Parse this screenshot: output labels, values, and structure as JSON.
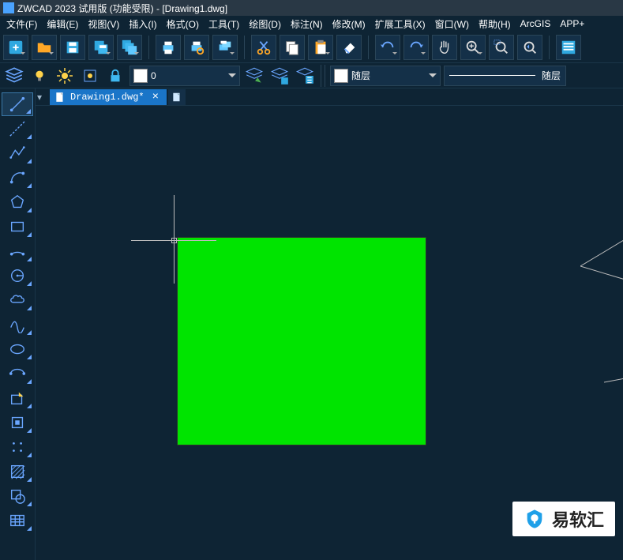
{
  "title": "ZWCAD 2023 试用版 (功能受限) - [Drawing1.dwg]",
  "menu": {
    "file": "文件(F)",
    "edit": "编辑(E)",
    "view": "视图(V)",
    "insert": "插入(I)",
    "format": "格式(O)",
    "tools": "工具(T)",
    "draw": "绘图(D)",
    "annotate": "标注(N)",
    "modify": "修改(M)",
    "ext": "扩展工具(X)",
    "window": "窗口(W)",
    "help": "帮助(H)",
    "arcgis": "ArcGIS",
    "appplus": "APP+"
  },
  "props": {
    "layer_name": "0",
    "color_label": "随层",
    "linetype_label": "随层"
  },
  "tab": {
    "filename": "Drawing1.dwg*"
  },
  "watermark": {
    "text": "易软汇"
  }
}
